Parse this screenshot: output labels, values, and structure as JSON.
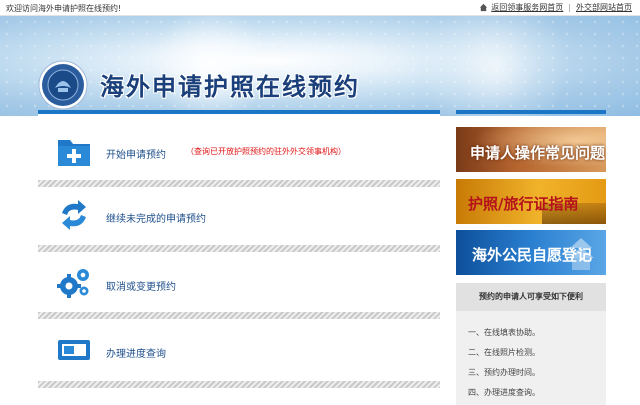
{
  "topbar": {
    "welcome": "欢迎访问海外申请护照在线预约!",
    "link_consular": "返回领事服务网首页",
    "separator": "|",
    "link_mfa": "外交部网站首页"
  },
  "header": {
    "title": "海外申请护照在线预约"
  },
  "options": [
    {
      "label": "开始申请预约",
      "note": "（查询已开放护照预约的驻外外交领事机构）"
    },
    {
      "label": "继续未完成的申请预约"
    },
    {
      "label": "取消或变更预约"
    },
    {
      "label": "办理进度查询"
    }
  ],
  "sidebar": {
    "banners": [
      {
        "label": "申请人操作常见问题"
      },
      {
        "label": "护照/旅行证指南"
      },
      {
        "label": "海外公民自愿登记"
      }
    ],
    "info_title": "预约的申请人可享受如下便利",
    "info_items": [
      "一、在线填表协助。",
      "二、在线照片检测。",
      "三、预约办理时间。",
      "四、办理进度查询。"
    ]
  },
  "colors": {
    "accent_blue": "#1b76c6",
    "title_blue": "#1a3f7a",
    "link_blue": "#1f4f8c",
    "note_red": "#e01414"
  },
  "icons": {
    "option_1": "folder-plus-icon",
    "option_2": "refresh-icon",
    "option_3": "gears-icon",
    "option_4": "monitor-icon"
  }
}
